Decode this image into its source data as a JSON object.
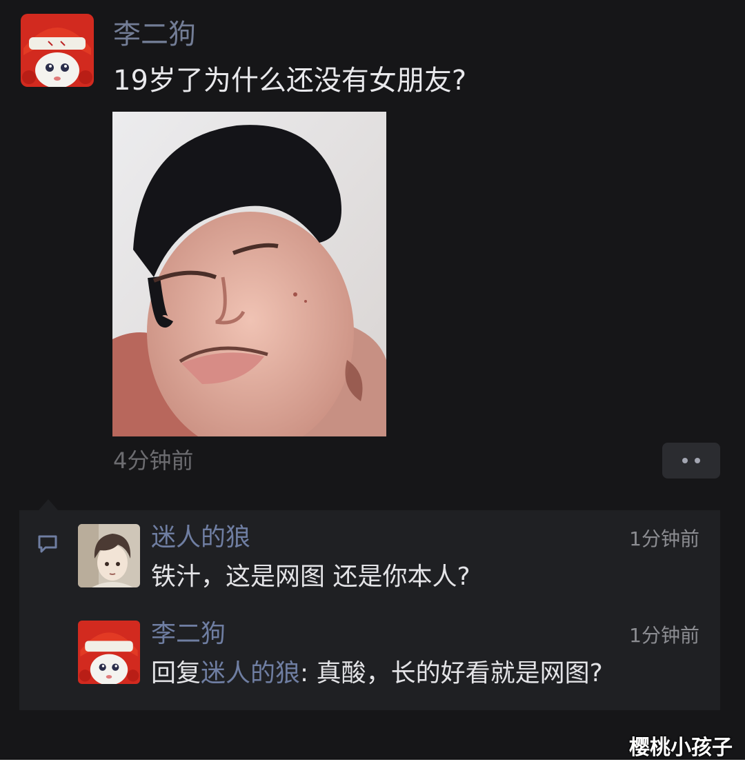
{
  "post": {
    "author": "李二狗",
    "text": "19岁了为什么还没有女朋友?",
    "time": "4分钟前",
    "avatar_icon": "red-hat-cartoon-avatar",
    "photo_icon": "selfie-photo"
  },
  "more_button": {
    "icon": "more-dots-icon"
  },
  "comments": [
    {
      "author": "迷人的狼",
      "time": "1分钟前",
      "text": "铁汁，这是网图 还是你本人?",
      "avatar_icon": "anime-boy-avatar"
    },
    {
      "author": "李二狗",
      "time": "1分钟前",
      "reply_prefix": "回复",
      "reply_to": "迷人的狼",
      "reply_text": ": 真酸，长的好看就是网图?",
      "avatar_icon": "red-hat-cartoon-avatar"
    }
  ],
  "watermark": "樱桃小孩子",
  "colors": {
    "background": "#161618",
    "panel": "#1f2023",
    "name_link": "#737d96",
    "text": "#e9e9ec"
  }
}
